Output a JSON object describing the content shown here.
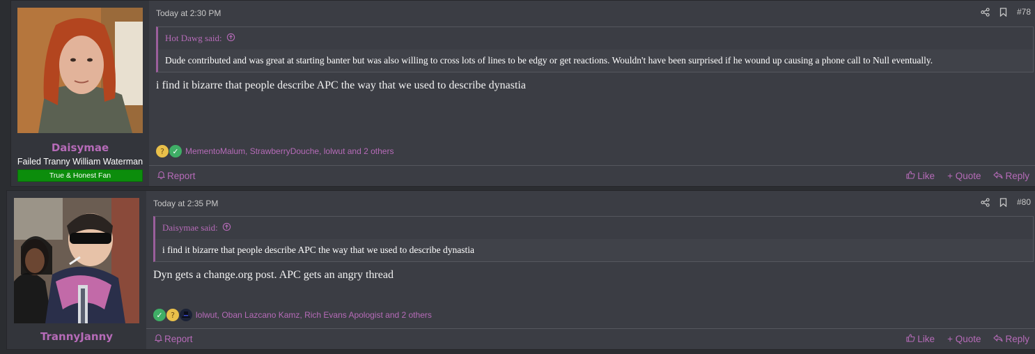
{
  "posts": [
    {
      "username": "Daisymae",
      "user_title": "Failed Tranny William Waterman",
      "banner": "True & Honest Fan",
      "date": "Today at 2:30 PM",
      "post_number": "#78",
      "quote_author": "Hot Dawg said:",
      "quote_text": "Dude contributed and was great at starting banter but was also willing to cross lots of lines to be edgy or get reactions. Wouldn't have been surprised if he wound up causing a phone call to Null eventually.",
      "message": "i find it bizarre that people describe APC the way that we used to describe dynastia",
      "reaction_icons": [
        "thinking-icon",
        "check-icon"
      ],
      "reaction_users": "MementoMalum, StrawberryDouche, lolwut and 2 others",
      "report_label": "Report",
      "like_label": "Like",
      "quote_label": "+ Quote",
      "reply_label": "Reply"
    },
    {
      "username": "TrannyJanny",
      "date": "Today at 2:35 PM",
      "post_number": "#80",
      "quote_author": "Daisymae said:",
      "quote_text": "i find it bizarre that people describe APC the way that we used to describe dynastia",
      "message": "Dyn gets a change.org post. APC gets an angry thread",
      "reaction_icons": [
        "check-icon",
        "thinking-icon",
        "top-hat-icon"
      ],
      "reaction_users": "lolwut, Oban Lazcano Kamz, Rich Evans Apologist and 2 others",
      "report_label": "Report",
      "like_label": "Like",
      "quote_label": "+ Quote",
      "reply_label": "Reply"
    }
  ],
  "colors": {
    "accent": "#b66bb8",
    "background": "#3b3d44",
    "banner_green": "#0c8d0c"
  }
}
